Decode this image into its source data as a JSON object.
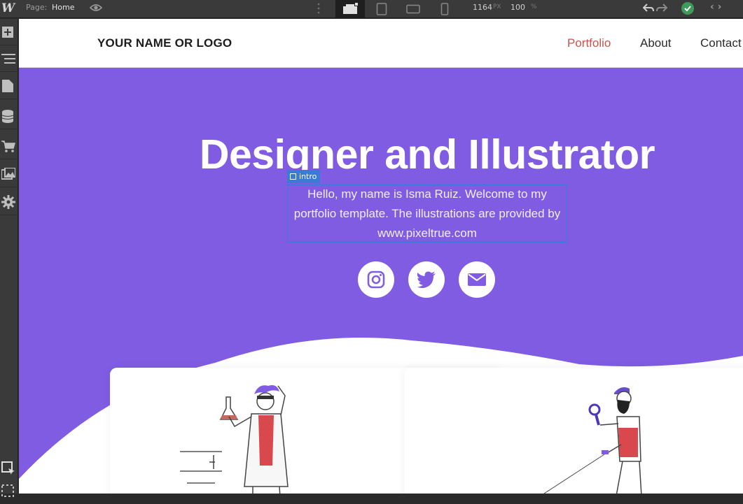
{
  "editor": {
    "logo": "W",
    "page_label": "Page:",
    "page_name": "Home",
    "canvas_width": "1164",
    "width_unit": "PX",
    "zoom": "100",
    "zoom_unit": "%"
  },
  "site": {
    "brand": "YOUR NAME OR LOGO",
    "nav": [
      {
        "label": "Portfolio",
        "active": true
      },
      {
        "label": "About",
        "active": false
      },
      {
        "label": "Contact",
        "active": false
      }
    ],
    "hero": {
      "title": "Designer and Illustrator",
      "intro_tag": "intro",
      "intro": "Hello, my name is Isma Ruiz. Welcome to my portfolio template. The illustrations are provided by www.pixeltrue.com"
    },
    "social_icons": [
      "instagram-icon",
      "twitter-icon",
      "email-icon"
    ]
  },
  "colors": {
    "hero_bg": "#7f5ce2",
    "accent": "#c5564e",
    "selection": "#3a7bd5"
  }
}
